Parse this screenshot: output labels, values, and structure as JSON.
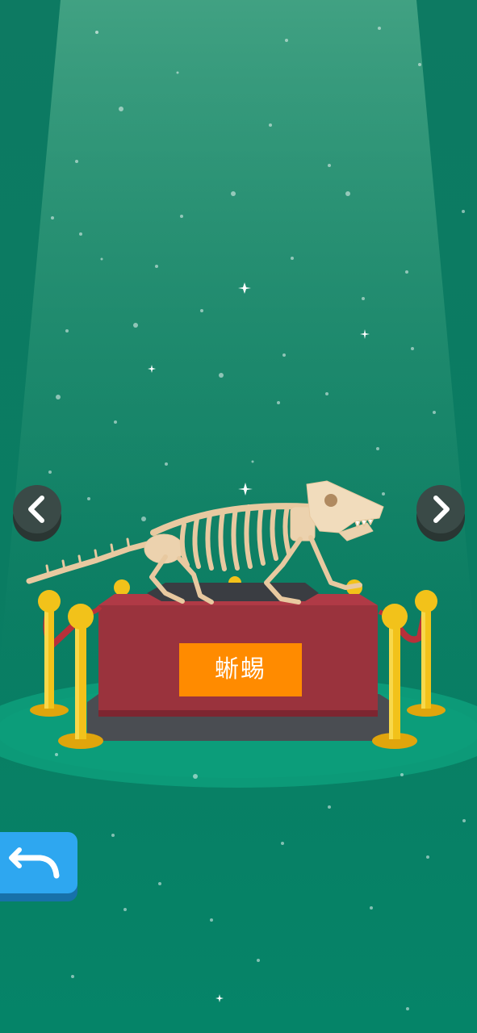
{
  "exhibit": {
    "name": "蜥蜴"
  },
  "icons": {
    "prev": "chevron-left-icon",
    "next": "chevron-right-icon",
    "back": "undo-arrow-icon"
  },
  "colors": {
    "background": "#0a7c62",
    "spotlight": "#3fa484",
    "floor_ellipse": "#0c9a78",
    "pedestal": "#9a333d",
    "nameplate": "#ff8b00",
    "rope": "#b8303a",
    "post_gold": "#f2c21a",
    "nav_button": "#3a4a47",
    "back_button": "#2ea7f0"
  }
}
